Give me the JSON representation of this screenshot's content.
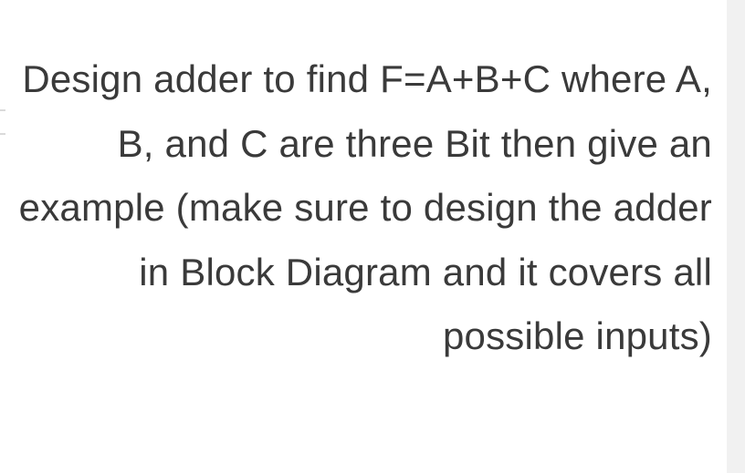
{
  "question": {
    "text": "Design adder to find F=A+B+C where A, B, and C are three Bit then give an example (make sure to design the adder in Block Diagram and it covers all possible inputs)"
  }
}
